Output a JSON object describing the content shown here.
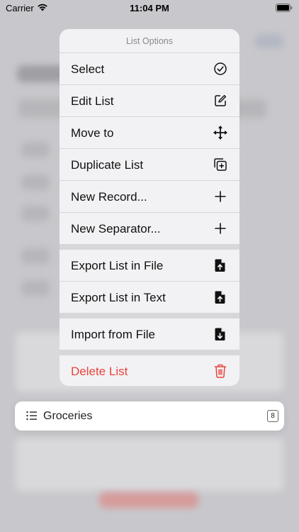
{
  "status_bar": {
    "carrier": "Carrier",
    "time": "11:04 PM"
  },
  "menu": {
    "title": "List Options",
    "groups": [
      [
        {
          "label": "Select",
          "icon": "checkmark-circle-icon"
        },
        {
          "label": "Edit List",
          "icon": "square-pencil-icon"
        },
        {
          "label": "Move to",
          "icon": "move-arrows-icon"
        },
        {
          "label": "Duplicate List",
          "icon": "duplicate-icon"
        },
        {
          "label": "New Record...",
          "icon": "plus-icon"
        },
        {
          "label": "New Separator...",
          "icon": "plus-icon"
        }
      ],
      [
        {
          "label": "Export List in File",
          "icon": "export-file-icon"
        },
        {
          "label": "Export List in Text",
          "icon": "export-text-icon"
        }
      ],
      [
        {
          "label": "Import from File",
          "icon": "import-file-icon"
        }
      ],
      [
        {
          "label": "Delete List",
          "icon": "trash-icon",
          "color": "#e8453c"
        }
      ]
    ]
  },
  "list_row": {
    "name": "Groceries",
    "count": "8",
    "icon": "list-icon"
  }
}
